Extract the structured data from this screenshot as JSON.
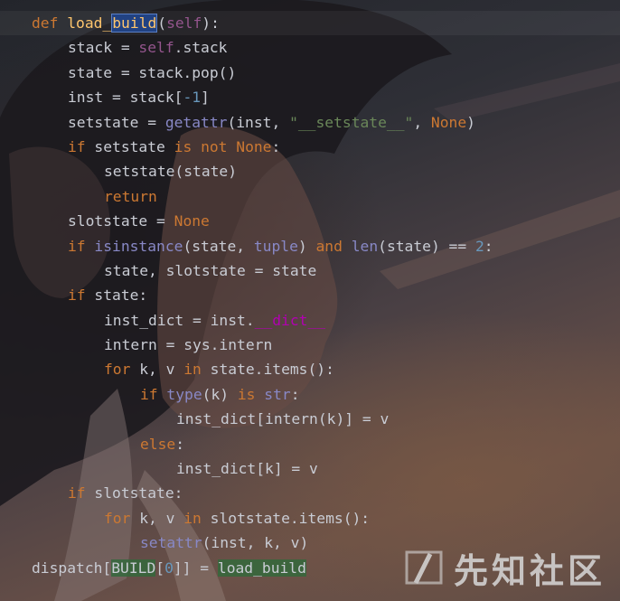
{
  "editor": {
    "colors": {
      "keyword": "#cc7832",
      "self": "#94558d",
      "function_name": "#ffc66d",
      "builtin": "#8888c6",
      "string": "#6a8759",
      "number": "#6897bb",
      "dunder": "#b200b2",
      "default": "#c9ccd4"
    },
    "lines": [
      {
        "indent": 0,
        "tokens": [
          {
            "t": "def ",
            "c": "kw"
          },
          {
            "t": "load_",
            "c": "fn"
          },
          {
            "t": "build",
            "c": "fn",
            "hl": "blue"
          },
          {
            "t": "(",
            "c": "name"
          },
          {
            "t": "self",
            "c": "self"
          },
          {
            "t": "):",
            "c": "name"
          }
        ]
      },
      {
        "indent": 1,
        "tokens": [
          {
            "t": "stack = ",
            "c": "name"
          },
          {
            "t": "self",
            "c": "self"
          },
          {
            "t": ".stack",
            "c": "name"
          }
        ]
      },
      {
        "indent": 1,
        "tokens": [
          {
            "t": "state = stack.pop()",
            "c": "name"
          }
        ]
      },
      {
        "indent": 1,
        "tokens": [
          {
            "t": "inst = stack[",
            "c": "name"
          },
          {
            "t": "-1",
            "c": "num"
          },
          {
            "t": "]",
            "c": "name"
          }
        ]
      },
      {
        "indent": 1,
        "tokens": [
          {
            "t": "setstate = ",
            "c": "name"
          },
          {
            "t": "getattr",
            "c": "builtin"
          },
          {
            "t": "(inst, ",
            "c": "name"
          },
          {
            "t": "\"__setstate__\"",
            "c": "str"
          },
          {
            "t": ", ",
            "c": "name"
          },
          {
            "t": "None",
            "c": "kw"
          },
          {
            "t": ")",
            "c": "name"
          }
        ]
      },
      {
        "indent": 1,
        "tokens": [
          {
            "t": "if ",
            "c": "kw"
          },
          {
            "t": "setstate ",
            "c": "name"
          },
          {
            "t": "is not None",
            "c": "kw"
          },
          {
            "t": ":",
            "c": "name"
          }
        ]
      },
      {
        "indent": 2,
        "tokens": [
          {
            "t": "setstate(state)",
            "c": "name"
          }
        ]
      },
      {
        "indent": 2,
        "tokens": [
          {
            "t": "return",
            "c": "kw"
          }
        ]
      },
      {
        "indent": 1,
        "tokens": [
          {
            "t": "slotstate = ",
            "c": "name"
          },
          {
            "t": "None",
            "c": "kw"
          }
        ]
      },
      {
        "indent": 1,
        "tokens": [
          {
            "t": "if ",
            "c": "kw"
          },
          {
            "t": "isinstance",
            "c": "builtin"
          },
          {
            "t": "(state, ",
            "c": "name"
          },
          {
            "t": "tuple",
            "c": "builtin"
          },
          {
            "t": ") ",
            "c": "name"
          },
          {
            "t": "and ",
            "c": "kw"
          },
          {
            "t": "len",
            "c": "builtin"
          },
          {
            "t": "(state) == ",
            "c": "name"
          },
          {
            "t": "2",
            "c": "num"
          },
          {
            "t": ":",
            "c": "name"
          }
        ]
      },
      {
        "indent": 2,
        "tokens": [
          {
            "t": "state, slotstate = state",
            "c": "name"
          }
        ]
      },
      {
        "indent": 1,
        "tokens": [
          {
            "t": "if ",
            "c": "kw"
          },
          {
            "t": "state:",
            "c": "name"
          }
        ]
      },
      {
        "indent": 2,
        "tokens": [
          {
            "t": "inst_dict = inst.",
            "c": "name"
          },
          {
            "t": "__dict__",
            "c": "dunder"
          }
        ]
      },
      {
        "indent": 2,
        "tokens": [
          {
            "t": "intern = sys.intern",
            "c": "name"
          }
        ]
      },
      {
        "indent": 2,
        "tokens": [
          {
            "t": "for ",
            "c": "kw"
          },
          {
            "t": "k, v ",
            "c": "name"
          },
          {
            "t": "in ",
            "c": "kw"
          },
          {
            "t": "state.items():",
            "c": "name"
          }
        ]
      },
      {
        "indent": 3,
        "tokens": [
          {
            "t": "if ",
            "c": "kw"
          },
          {
            "t": "type",
            "c": "builtin"
          },
          {
            "t": "(k) ",
            "c": "name"
          },
          {
            "t": "is ",
            "c": "kw"
          },
          {
            "t": "str",
            "c": "builtin"
          },
          {
            "t": ":",
            "c": "name"
          }
        ]
      },
      {
        "indent": 4,
        "tokens": [
          {
            "t": "inst_dict[intern(k)] = v",
            "c": "name"
          }
        ]
      },
      {
        "indent": 3,
        "tokens": [
          {
            "t": "else",
            "c": "kw"
          },
          {
            "t": ":",
            "c": "name"
          }
        ]
      },
      {
        "indent": 4,
        "tokens": [
          {
            "t": "inst_dict[k] = v",
            "c": "name"
          }
        ]
      },
      {
        "indent": 1,
        "tokens": [
          {
            "t": "if ",
            "c": "kw"
          },
          {
            "t": "slotstate:",
            "c": "name"
          }
        ]
      },
      {
        "indent": 2,
        "tokens": [
          {
            "t": "for ",
            "c": "kw"
          },
          {
            "t": "k, v ",
            "c": "name"
          },
          {
            "t": "in ",
            "c": "kw"
          },
          {
            "t": "slotstate.items():",
            "c": "name"
          }
        ]
      },
      {
        "indent": 3,
        "tokens": [
          {
            "t": "setattr",
            "c": "builtin"
          },
          {
            "t": "(inst, k, v)",
            "c": "name"
          }
        ]
      },
      {
        "indent": 0,
        "tokens": [
          {
            "t": "dispatch[",
            "c": "name"
          },
          {
            "t": "BUILD",
            "c": "name",
            "hl": "green"
          },
          {
            "t": "[",
            "c": "name"
          },
          {
            "t": "0",
            "c": "num"
          },
          {
            "t": "]] = ",
            "c": "name"
          },
          {
            "t": "load_build",
            "c": "name",
            "hl": "green"
          }
        ]
      }
    ]
  },
  "watermark": {
    "text": "先知社区",
    "icon": "xianzhi-logo-icon"
  }
}
